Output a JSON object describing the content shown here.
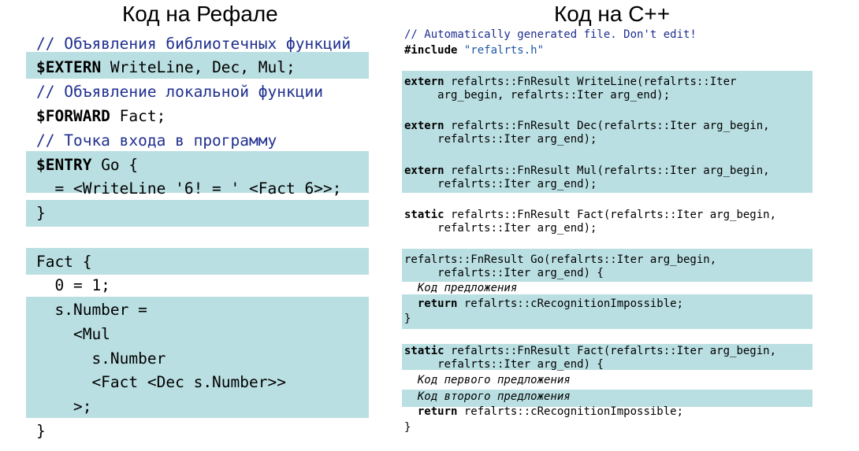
{
  "titles": {
    "left": "Код на Рефале",
    "right": "Код на С++"
  },
  "refal": {
    "comment_externs": "// Объявления библиотечных функций",
    "extern_kw": "$EXTERN",
    "extern_rest": " WriteLine, Dec, Mul;",
    "comment_forward": "// Объявление локальной функции",
    "forward_kw": "$FORWARD",
    "forward_rest": " Fact;",
    "comment_entry": "// Точка входа в программу",
    "entry_kw": "$ENTRY",
    "entry_rest": " Go {",
    "go_body": "  = <WriteLine '6! = ' <Fact 6>>;",
    "close1": "}",
    "fact_head": "Fact {",
    "fact_l1": "  0 = 1;",
    "fact_l2": "  s.Number =",
    "fact_l3": "    <Mul",
    "fact_l4": "      s.Number",
    "fact_l5": "      <Fact <Dec s.Number>>",
    "fact_l6": "    >;",
    "close2": "}"
  },
  "cpp": {
    "comment": "// Automatically generated file. Don't edit!",
    "include_kw": "#include",
    "include_str": "\"refalrts.h\"",
    "extern_kw": "extern",
    "ext1_a": " refalrts::FnResult WriteLine(refalrts::Iter",
    "ext1_b": "     arg_begin, refalrts::Iter arg_end);",
    "ext2_a": " refalrts::FnResult Dec(refalrts::Iter arg_begin,",
    "ext2_b": "     refalrts::Iter arg_end);",
    "ext3_a": " refalrts::FnResult Mul(refalrts::Iter arg_begin,",
    "ext3_b": "     refalrts::Iter arg_end);",
    "static_kw": "static",
    "fwd_a": " refalrts::FnResult Fact(refalrts::Iter arg_begin,",
    "fwd_b": "     refalrts::Iter arg_end);",
    "go_a": "refalrts::FnResult Go(refalrts::Iter arg_begin,",
    "go_b": "     refalrts::Iter arg_end) {",
    "go_body_comment": "  Код предложения",
    "return_kw": "return",
    "return_rest": " refalrts::cRecognitionImpossible;",
    "close": "}",
    "fact_a": " refalrts::FnResult Fact(refalrts::Iter arg_begin,",
    "fact_b": "     refalrts::Iter arg_end) {",
    "fact_c1": "  Код первого предложения",
    "fact_c2": "  Код второго предложения"
  }
}
